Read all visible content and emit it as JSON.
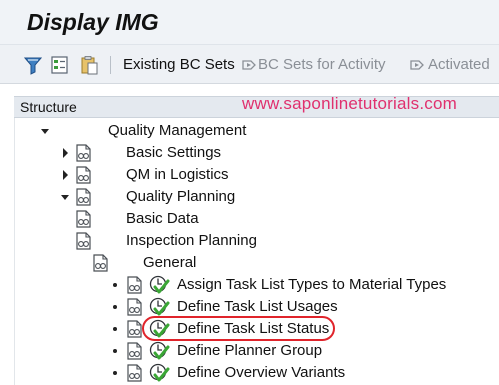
{
  "title": "Display IMG",
  "toolbar": {
    "icons": [
      "filter-icon",
      "expand-tree-icon",
      "clipboard-icon"
    ],
    "existing_bc_sets": "Existing BC Sets",
    "bc_sets_for_activity": "BC Sets for Activity",
    "activated": "Activated"
  },
  "structure": {
    "header": "Structure",
    "watermark": "www.saponlinetutorials.com"
  },
  "tree": [
    {
      "label": "Quality Management",
      "level": 0,
      "state": "expanded",
      "icon": "none"
    },
    {
      "label": "Basic Settings",
      "level": 1,
      "state": "collapsed",
      "icon": "folder-doc-icon"
    },
    {
      "label": "QM in Logistics",
      "level": 1,
      "state": "collapsed",
      "icon": "folder-doc-icon"
    },
    {
      "label": "Quality Planning",
      "level": 1,
      "state": "expanded",
      "icon": "folder-doc-icon"
    },
    {
      "label": "Basic Data",
      "level": 2,
      "state": "collapsed",
      "icon": "folder-doc-icon"
    },
    {
      "label": "Inspection Planning",
      "level": 2,
      "state": "expanded",
      "icon": "folder-doc-icon"
    },
    {
      "label": "General",
      "level": 3,
      "state": "expanded",
      "icon": "folder-doc-icon"
    },
    {
      "label": "Assign Task List Types to Material Types",
      "level": 4,
      "state": "leaf",
      "icon": "execute-icon"
    },
    {
      "label": "Define Task List Usages",
      "level": 4,
      "state": "leaf",
      "icon": "execute-icon"
    },
    {
      "label": "Define Task List Status",
      "level": 4,
      "state": "leaf",
      "icon": "execute-icon",
      "highlighted": true
    },
    {
      "label": "Define Planner Group",
      "level": 4,
      "state": "leaf",
      "icon": "execute-icon"
    },
    {
      "label": "Define Overview Variants",
      "level": 4,
      "state": "leaf",
      "icon": "execute-icon"
    }
  ],
  "colors": {
    "highlight": "#e0242b",
    "watermark": "#e0306e",
    "check": "#3aa635"
  }
}
